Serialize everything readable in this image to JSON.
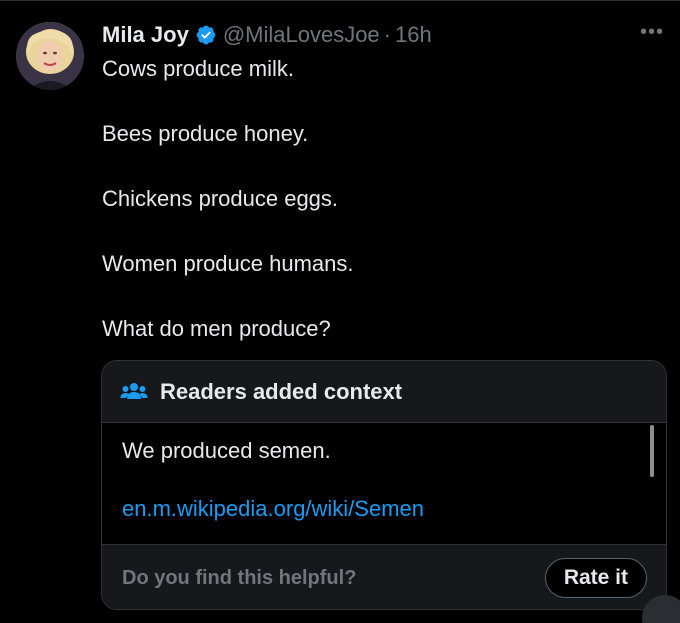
{
  "tweet": {
    "author_name": "Mila Joy",
    "handle": "@MilaLovesJoe",
    "separator": "·",
    "time": "16h",
    "more_icon": "more-horizontal-icon",
    "verified_icon": "verified-badge-icon",
    "lines": [
      "Cows produce milk.",
      "Bees produce honey.",
      "Chickens produce eggs.",
      "Women produce humans.",
      "What do men produce?"
    ]
  },
  "community_note": {
    "header_icon": "people-icon",
    "title": "Readers added context",
    "text": "We produced semen.",
    "link": "en.m.wikipedia.org/wiki/Semen",
    "helpful_prompt": "Do you find this helpful?",
    "rate_label": "Rate it"
  },
  "colors": {
    "background": "#000000",
    "text": "#e7e9ea",
    "muted": "#71767b",
    "link": "#1d9bf0",
    "verified": "#1d9bf0",
    "border": "#2f3336",
    "note_header_bg": "#16181c"
  }
}
